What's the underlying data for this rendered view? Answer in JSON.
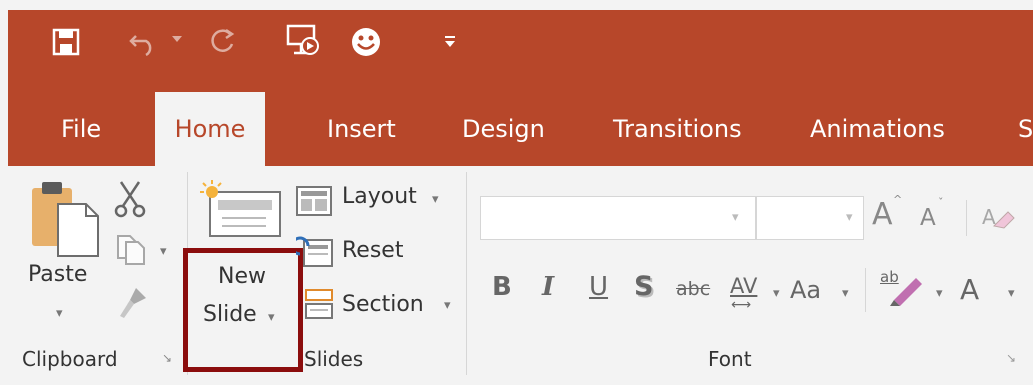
{
  "colors": {
    "brand": "#b7472a",
    "ribbon_bg": "#f3f3f3",
    "highlight_box": "#8b0d0d"
  },
  "quick_access": [
    {
      "icon": "save-icon"
    },
    {
      "icon": "undo-icon"
    },
    {
      "icon": "redo-icon"
    },
    {
      "icon": "start-slideshow-icon"
    },
    {
      "icon": "smiley-feedback-icon"
    },
    {
      "icon": "customize-quick-access-icon"
    }
  ],
  "tabs": {
    "file": "File",
    "home": "Home",
    "insert": "Insert",
    "design": "Design",
    "transitions": "Transitions",
    "animations": "Animations",
    "slideshow_partial": "S"
  },
  "active_tab": "Home",
  "clipboard": {
    "paste": "Paste",
    "group_label": "Clipboard"
  },
  "slides": {
    "new_slide_line1": "New",
    "new_slide_line2": "Slide",
    "layout": "Layout",
    "reset": "Reset",
    "section": "Section",
    "group_label": "Slides"
  },
  "font": {
    "font_name_value": "",
    "font_size_value": "",
    "grow_label": "A",
    "shrink_label": "A",
    "bold": "B",
    "italic": "I",
    "underline": "U",
    "shadow": "S",
    "strikethrough": "abc",
    "spacing": "AV",
    "change_case": "Aa",
    "highlight": "ab",
    "font_color": "A",
    "group_label": "Font"
  }
}
